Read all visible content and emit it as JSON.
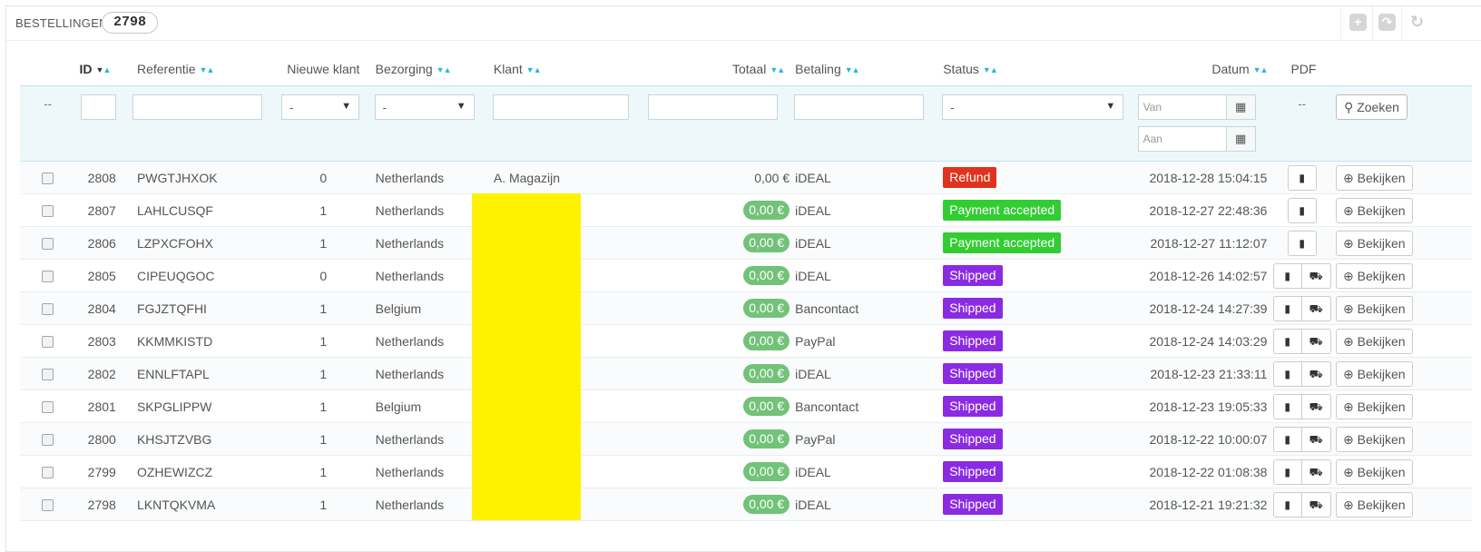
{
  "panel": {
    "title": "BESTELLINGEN",
    "count": "2798",
    "toolbar": [
      "add-icon",
      "export-icon",
      "refresh-icon"
    ]
  },
  "columns": {
    "id": "ID",
    "reference": "Referentie",
    "new_customer": "Nieuwe klant",
    "delivery": "Bezorging",
    "customer": "Klant",
    "total": "Totaal",
    "payment": "Betaling",
    "status": "Status",
    "date": "Datum",
    "pdf": "PDF"
  },
  "filters": {
    "check_placeholder": "--",
    "new_customer_value": "-",
    "delivery_value": "-",
    "status_value": "-",
    "date_from_placeholder": "Van",
    "date_to_placeholder": "Aan",
    "pdf_placeholder": "--",
    "search_label": "Zoeken"
  },
  "view_label": "Bekijken",
  "orders": [
    {
      "id": "2808",
      "ref": "PWGTJHXOK",
      "new": "0",
      "country": "Netherlands",
      "customer": "A. Magazijn",
      "total": "0,00 €",
      "total_pill": false,
      "payment": "iDEAL",
      "status": "Refund",
      "status_type": "refund",
      "date": "2018-12-28 15:04:15",
      "delivery_slip": false
    },
    {
      "id": "2807",
      "ref": "LAHLCUSQF",
      "new": "1",
      "country": "Netherlands",
      "customer": "",
      "total": "0,00 €",
      "total_pill": true,
      "payment": "iDEAL",
      "status": "Payment accepted",
      "status_type": "accepted",
      "date": "2018-12-27 22:48:36",
      "delivery_slip": false
    },
    {
      "id": "2806",
      "ref": "LZPXCFOHX",
      "new": "1",
      "country": "Netherlands",
      "customer": "",
      "total": "0,00 €",
      "total_pill": true,
      "payment": "iDEAL",
      "status": "Payment accepted",
      "status_type": "accepted",
      "date": "2018-12-27 11:12:07",
      "delivery_slip": false
    },
    {
      "id": "2805",
      "ref": "CIPEUQGOC",
      "new": "0",
      "country": "Netherlands",
      "customer": "",
      "total": "0,00 €",
      "total_pill": true,
      "payment": "iDEAL",
      "status": "Shipped",
      "status_type": "shipped",
      "date": "2018-12-26 14:02:57",
      "delivery_slip": true
    },
    {
      "id": "2804",
      "ref": "FGJZTQFHI",
      "new": "1",
      "country": "Belgium",
      "customer": "",
      "total": "0,00 €",
      "total_pill": true,
      "payment": "Bancontact",
      "status": "Shipped",
      "status_type": "shipped",
      "date": "2018-12-24 14:27:39",
      "delivery_slip": true
    },
    {
      "id": "2803",
      "ref": "KKMMKISTD",
      "new": "1",
      "country": "Netherlands",
      "customer": "",
      "total": "0,00 €",
      "total_pill": true,
      "payment": "PayPal",
      "status": "Shipped",
      "status_type": "shipped",
      "date": "2018-12-24 14:03:29",
      "delivery_slip": true
    },
    {
      "id": "2802",
      "ref": "ENNLFTAPL",
      "new": "1",
      "country": "Netherlands",
      "customer": "",
      "total": "0,00 €",
      "total_pill": true,
      "payment": "iDEAL",
      "status": "Shipped",
      "status_type": "shipped",
      "date": "2018-12-23 21:33:11",
      "delivery_slip": true
    },
    {
      "id": "2801",
      "ref": "SKPGLIPPW",
      "new": "1",
      "country": "Belgium",
      "customer": "",
      "total": "0,00 €",
      "total_pill": true,
      "payment": "Bancontact",
      "status": "Shipped",
      "status_type": "shipped",
      "date": "2018-12-23 19:05:33",
      "delivery_slip": true
    },
    {
      "id": "2800",
      "ref": "KHSJTZVBG",
      "new": "1",
      "country": "Netherlands",
      "customer": "",
      "total": "0,00 €",
      "total_pill": true,
      "payment": "PayPal",
      "status": "Shipped",
      "status_type": "shipped",
      "date": "2018-12-22 10:00:07",
      "delivery_slip": true
    },
    {
      "id": "2799",
      "ref": "OZHEWIZCZ",
      "new": "1",
      "country": "Netherlands",
      "customer": "",
      "total": "0,00 €",
      "total_pill": true,
      "payment": "iDEAL",
      "status": "Shipped",
      "status_type": "shipped",
      "date": "2018-12-22 01:08:38",
      "delivery_slip": true
    },
    {
      "id": "2798",
      "ref": "LKNTQKVMA",
      "new": "1",
      "country": "Netherlands",
      "customer": "",
      "total": "0,00 €",
      "total_pill": true,
      "payment": "iDEAL",
      "status": "Shipped",
      "status_type": "shipped",
      "date": "2018-12-21 19:21:32",
      "delivery_slip": true
    }
  ],
  "colors": {
    "accent": "#25b9d7",
    "refund": "#e0321c",
    "accepted": "#32cd32",
    "shipped": "#8a2be2",
    "total_pill": "#72c279",
    "redaction": "#fff200"
  }
}
